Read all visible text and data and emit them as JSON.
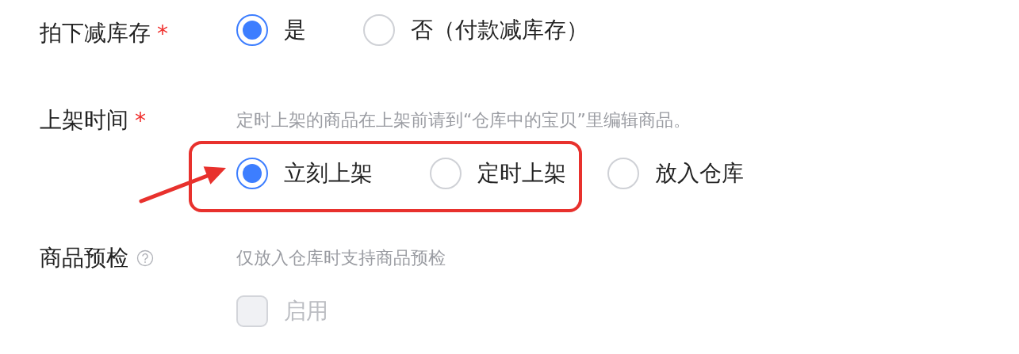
{
  "rows": [
    {
      "label": "拍下减库存",
      "required_mark": "*",
      "options": [
        {
          "label": "是",
          "selected": true,
          "boxed": false
        },
        {
          "label": "否（付款减库存）",
          "selected": false,
          "boxed": false
        }
      ]
    },
    {
      "label": "上架时间",
      "required_mark": "*",
      "hint": "定时上架的商品在上架前请到“仓库中的宝贝”里编辑商品。",
      "options": [
        {
          "label": "立刻上架",
          "selected": true,
          "boxed": true
        },
        {
          "label": "定时上架",
          "selected": false,
          "boxed": true
        },
        {
          "label": "放入仓库",
          "selected": false,
          "boxed": false
        }
      ]
    },
    {
      "label": "商品预检",
      "help": true,
      "hint": "仅放入仓库时支持商品预检",
      "checkbox": {
        "label": "启用",
        "checked": false,
        "disabled": true
      }
    }
  ]
}
